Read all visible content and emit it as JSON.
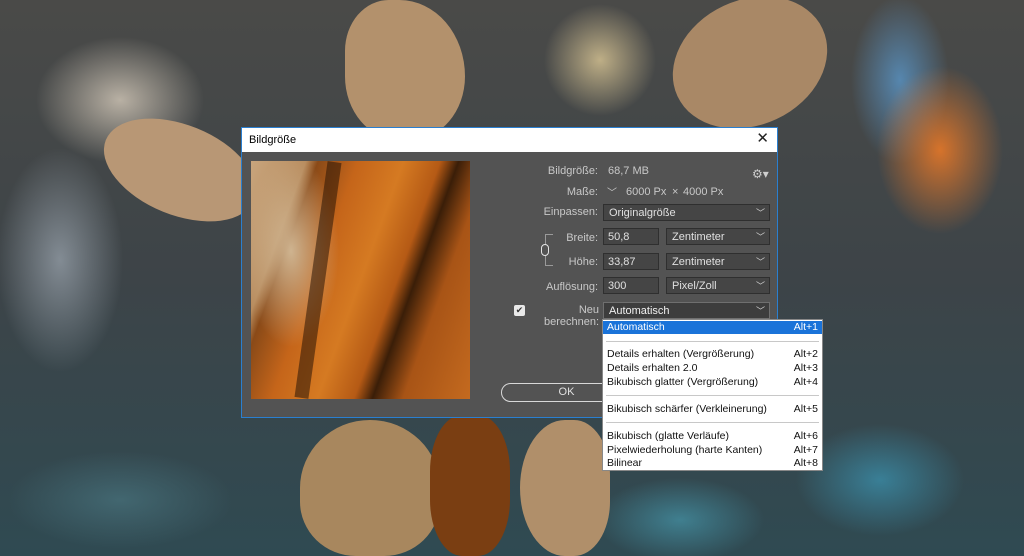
{
  "dialog": {
    "title": "Bildgröße",
    "close_glyph": "✕",
    "gear_glyph": "⚙▾",
    "image_size_label": "Bildgröße:",
    "image_size_value": "68,7 MB",
    "dimensions_label": "Maße:",
    "dimensions_width": "6000 Px",
    "dimensions_times": "×",
    "dimensions_height": "4000 Px",
    "fit_label": "Einpassen:",
    "fit_value": "Originalgröße",
    "width_label": "Breite:",
    "width_value": "50,8",
    "width_unit": "Zentimeter",
    "height_label": "Höhe:",
    "height_value": "33,87",
    "height_unit": "Zentimeter",
    "resolution_label": "Auflösung:",
    "resolution_value": "300",
    "resolution_unit": "Pixel/Zoll",
    "resample_label": "Neu berechnen:",
    "resample_checked": true,
    "resample_value": "Automatisch",
    "ok_label": "OK"
  },
  "resample_options": [
    {
      "label": "Automatisch",
      "shortcut": "Alt+1",
      "selected": true
    },
    {
      "label": "Details erhalten (Vergrößerung)",
      "shortcut": "Alt+2"
    },
    {
      "label": "Details erhalten 2.0",
      "shortcut": "Alt+3"
    },
    {
      "label": "Bikubisch glatter (Vergrößerung)",
      "shortcut": "Alt+4"
    },
    {
      "label": "Bikubisch schärfer (Verkleinerung)",
      "shortcut": "Alt+5"
    },
    {
      "label": "Bikubisch (glatte Verläufe)",
      "shortcut": "Alt+6"
    },
    {
      "label": "Pixelwiederholung (harte Kanten)",
      "shortcut": "Alt+7"
    },
    {
      "label": "Bilinear",
      "shortcut": "Alt+8"
    }
  ],
  "icons": [
    "close-icon",
    "gear-icon",
    "chevron-down-icon",
    "link-chain-icon",
    "checkmark-icon"
  ],
  "colors": {
    "accent": "#1a73d9",
    "dialog_bg": "#535353",
    "border": "#2a7fd0"
  }
}
